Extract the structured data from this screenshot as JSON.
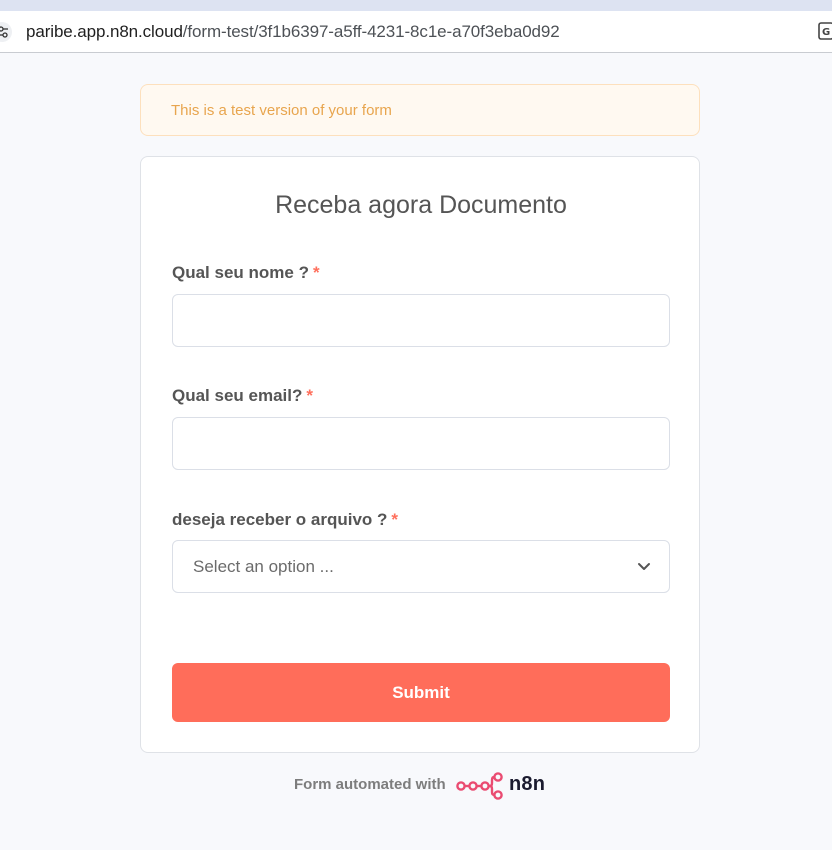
{
  "browser": {
    "url_host": "paribe.app.n8n.cloud",
    "url_path": "/form-test/3f1b6397-a5ff-4231-8c1e-a70f3eba0d92"
  },
  "banner": {
    "text": "This is a test version of your form"
  },
  "form": {
    "title": "Receba agora Documento",
    "fields": [
      {
        "label": "Qual seu nome ?",
        "required_mark": "*",
        "value": ""
      },
      {
        "label": "Qual seu email?",
        "required_mark": "*",
        "value": ""
      },
      {
        "label": "deseja receber o arquivo ?",
        "required_mark": "*",
        "placeholder": "Select an option ..."
      }
    ],
    "submit_label": "Submit"
  },
  "footer": {
    "text": "Form automated with",
    "brand": "n8n"
  },
  "colors": {
    "accent": "#ff6d5a",
    "banner_text": "#e8a54e",
    "banner_bg": "#fff9f1",
    "required": "#ff6f5c",
    "logo_pink": "#ea4b71"
  },
  "icons": [
    "site-settings-icon",
    "translate-icon",
    "chevron-down-icon",
    "n8n-logo-icon"
  ]
}
